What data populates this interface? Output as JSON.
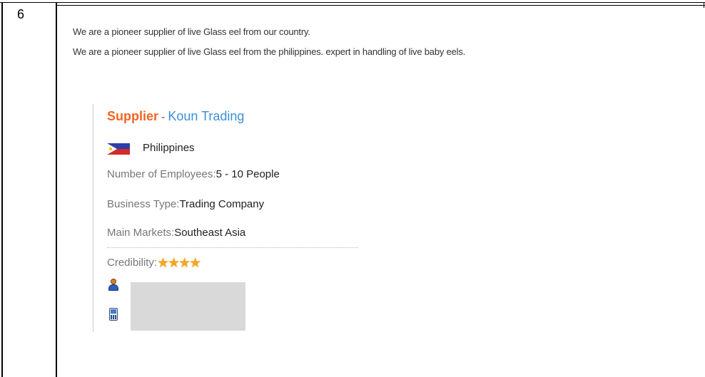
{
  "row": {
    "number": "6"
  },
  "description": {
    "line1": "We are a pioneer supplier of live Glass eel from our country.",
    "line2": "We are a pioneer supplier of live Glass eel from the philippines. expert in handling of live baby eels."
  },
  "supplier": {
    "label": "Supplier",
    "separator": " - ",
    "name": "Koun Trading",
    "country": "Philippines",
    "flag_icon": "philippines-flag-icon",
    "fields": [
      {
        "key": "Number of Employees:",
        "value": "5 - 10 People"
      },
      {
        "key": "Business Type:",
        "value": "Trading Company"
      },
      {
        "key": "Main Markets:",
        "value": "Southeast Asia"
      }
    ],
    "credibility": {
      "key": "Credibility:",
      "stars": 4,
      "star_icon": "star-icon"
    },
    "contact_icons": [
      "person-icon",
      "mobile-phone-icon"
    ]
  },
  "colors": {
    "supplier_label": "#f26522",
    "supplier_name": "#3a8fd9",
    "star": "#f5a623",
    "redaction": "#d9d9d9"
  }
}
